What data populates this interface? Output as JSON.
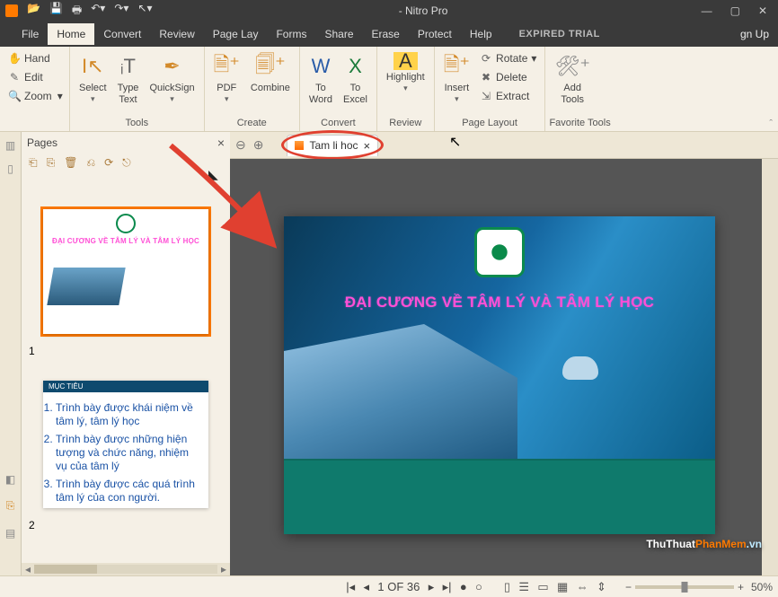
{
  "titlebar": {
    "title": "- Nitro Pro"
  },
  "menubar": {
    "tabs": [
      "File",
      "Home",
      "Convert",
      "Review",
      "Page Lay",
      "Forms",
      "Share",
      "Erase",
      "Protect",
      "Help"
    ],
    "active_index": 1,
    "trial": "EXPIRED TRIAL",
    "signup": "gn Up"
  },
  "ribbon": {
    "hand": "Hand",
    "edit": "Edit",
    "zoom": "Zoom",
    "select": "Select",
    "typetext": "Type\nText",
    "quicksign": "QuickSign",
    "pdf": "PDF",
    "combine": "Combine",
    "toword": "To\nWord",
    "toexcel": "To\nExcel",
    "highlight": "Highlight",
    "insert": "Insert",
    "rotate": "Rotate",
    "delete": "Delete",
    "extract": "Extract",
    "addtools": "Add\nTools",
    "groups": {
      "tools": "Tools",
      "create": "Create",
      "convert": "Convert",
      "review": "Review",
      "pagelayout": "Page Layout",
      "favorite": "Favorite Tools"
    }
  },
  "pages": {
    "header": "Pages",
    "thumb1_title": "ĐẠI CƯƠNG VỀ TÂM LÝ VÀ TÂM LÝ HỌC",
    "thumb2_header": "MỤC TIÊU",
    "thumb2_items": [
      "Trình bày được khái niệm về tâm lý, tâm lý học",
      "Trình bày được những hiện tượng và chức năng, nhiệm vụ của tâm lý",
      "Trình bày được các quá trình tâm lý của con người."
    ],
    "num1": "1",
    "num2": "2"
  },
  "doc": {
    "tab_name": "Tam li hoc",
    "slide_title": "ĐẠI CƯƠNG VỀ TÂM LÝ VÀ TÂM LÝ HỌC"
  },
  "status": {
    "page": "1 OF 36",
    "zoom_pct": "50%"
  },
  "watermark": {
    "a": "ThuThuat",
    "b": "PhanMem",
    "c": ".vn"
  }
}
